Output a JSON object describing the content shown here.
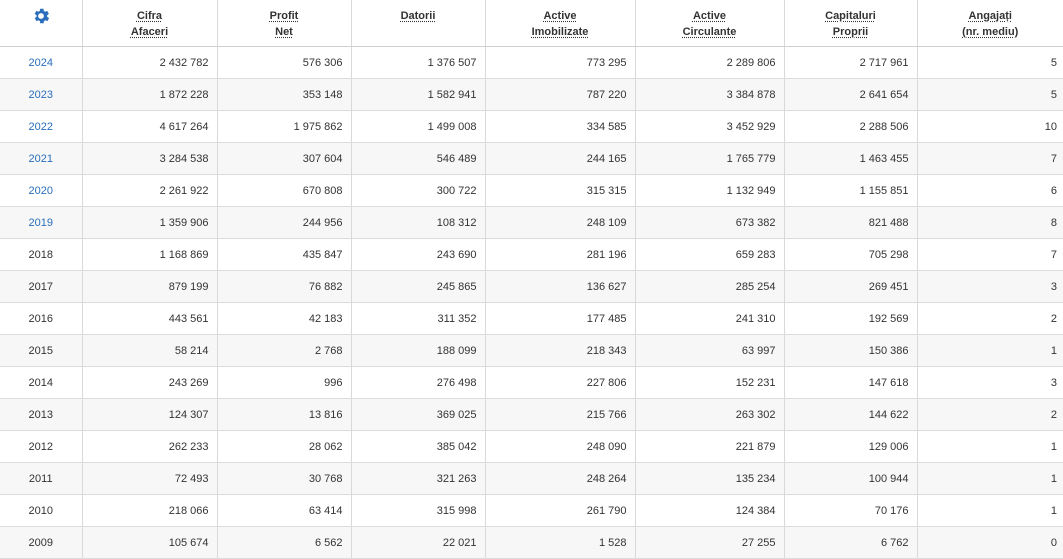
{
  "header": {
    "settings_icon": "gear-icon",
    "columns": [
      {
        "key": "cifra",
        "l1": "Cifra",
        "l2": "Afaceri"
      },
      {
        "key": "profit",
        "l1": "Profit",
        "l2": "Net"
      },
      {
        "key": "datorii",
        "l1": "Datorii",
        "l2": ""
      },
      {
        "key": "imob",
        "l1": "Active",
        "l2": "Imobilizate"
      },
      {
        "key": "circ",
        "l1": "Active",
        "l2": "Circulante"
      },
      {
        "key": "cap",
        "l1": "Capitaluri",
        "l2": "Proprii"
      },
      {
        "key": "ang",
        "l1": "Angajați",
        "l2": "(nr. mediu)"
      }
    ]
  },
  "accent_color": "#2a6ebb",
  "rows": [
    {
      "year": "2024",
      "link": true,
      "vals": [
        "2 432 782",
        "576 306",
        "1 376 507",
        "773 295",
        "2 289 806",
        "2 717 961",
        "5"
      ]
    },
    {
      "year": "2023",
      "link": true,
      "vals": [
        "1 872 228",
        "353 148",
        "1 582 941",
        "787 220",
        "3 384 878",
        "2 641 654",
        "5"
      ]
    },
    {
      "year": "2022",
      "link": true,
      "vals": [
        "4 617 264",
        "1 975 862",
        "1 499 008",
        "334 585",
        "3 452 929",
        "2 288 506",
        "10"
      ]
    },
    {
      "year": "2021",
      "link": true,
      "vals": [
        "3 284 538",
        "307 604",
        "546 489",
        "244 165",
        "1 765 779",
        "1 463 455",
        "7"
      ]
    },
    {
      "year": "2020",
      "link": true,
      "vals": [
        "2 261 922",
        "670 808",
        "300 722",
        "315 315",
        "1 132 949",
        "1 155 851",
        "6"
      ]
    },
    {
      "year": "2019",
      "link": true,
      "vals": [
        "1 359 906",
        "244 956",
        "108 312",
        "248 109",
        "673 382",
        "821 488",
        "8"
      ]
    },
    {
      "year": "2018",
      "link": false,
      "vals": [
        "1 168 869",
        "435 847",
        "243 690",
        "281 196",
        "659 283",
        "705 298",
        "7"
      ]
    },
    {
      "year": "2017",
      "link": false,
      "vals": [
        "879 199",
        "76 882",
        "245 865",
        "136 627",
        "285 254",
        "269 451",
        "3"
      ]
    },
    {
      "year": "2016",
      "link": false,
      "vals": [
        "443 561",
        "42 183",
        "311 352",
        "177 485",
        "241 310",
        "192 569",
        "2"
      ]
    },
    {
      "year": "2015",
      "link": false,
      "vals": [
        "58 214",
        "2 768",
        "188 099",
        "218 343",
        "63 997",
        "150 386",
        "1"
      ]
    },
    {
      "year": "2014",
      "link": false,
      "vals": [
        "243 269",
        "996",
        "276 498",
        "227 806",
        "152 231",
        "147 618",
        "3"
      ]
    },
    {
      "year": "2013",
      "link": false,
      "vals": [
        "124 307",
        "13 816",
        "369 025",
        "215 766",
        "263 302",
        "144 622",
        "2"
      ]
    },
    {
      "year": "2012",
      "link": false,
      "vals": [
        "262 233",
        "28 062",
        "385 042",
        "248 090",
        "221 879",
        "129 006",
        "1"
      ]
    },
    {
      "year": "2011",
      "link": false,
      "vals": [
        "72 493",
        "30 768",
        "321 263",
        "248 264",
        "135 234",
        "100 944",
        "1"
      ]
    },
    {
      "year": "2010",
      "link": false,
      "vals": [
        "218 066",
        "63 414",
        "315 998",
        "261 790",
        "124 384",
        "70 176",
        "1"
      ]
    },
    {
      "year": "2009",
      "link": false,
      "vals": [
        "105 674",
        "6 562",
        "22 021",
        "1 528",
        "27 255",
        "6 762",
        "0"
      ]
    }
  ]
}
